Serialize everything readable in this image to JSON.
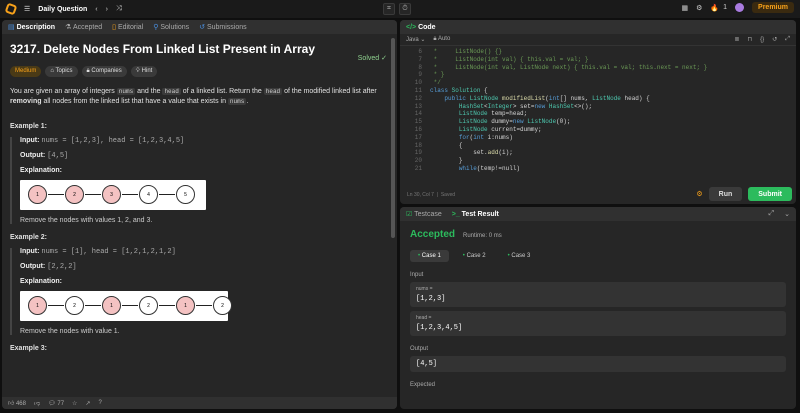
{
  "topbar": {
    "title": "Daily Question",
    "streak": "1",
    "premium": "Premium"
  },
  "left_tabs": [
    "Description",
    "Accepted",
    "Editorial",
    "Solutions",
    "Submissions"
  ],
  "problem": {
    "title": "3217. Delete Nodes From Linked List Present in Array",
    "solved": "Solved",
    "tags": [
      "Medium",
      "Topics",
      "Companies",
      "Hint"
    ],
    "desc_1": "You are given an array of integers",
    "desc_nums": "nums",
    "desc_2": "and the",
    "desc_head": "head",
    "desc_3": "of a linked list. Return the",
    "desc_head2": "head",
    "desc_4": "of the modified linked list after",
    "desc_bold": "removing",
    "desc_5": "all nodes from the linked list that have a value that exists in",
    "desc_nums2": "nums",
    "desc_6": "."
  },
  "examples": [
    {
      "title": "Example 1:",
      "input_label": "Input:",
      "input": "nums = [1,2,3], head = [1,2,3,4,5]",
      "output_label": "Output:",
      "output": "[4,5]",
      "expl_label": "Explanation:",
      "nodes": [
        {
          "v": "1",
          "r": true
        },
        {
          "v": "2",
          "r": true
        },
        {
          "v": "3",
          "r": true
        },
        {
          "v": "4",
          "r": false
        },
        {
          "v": "5",
          "r": false
        }
      ],
      "note": "Remove the nodes with values 1, 2, and 3."
    },
    {
      "title": "Example 2:",
      "input_label": "Input:",
      "input": "nums = [1], head = [1,2,1,2,1,2]",
      "output_label": "Output:",
      "output": "[2,2,2]",
      "expl_label": "Explanation:",
      "nodes": [
        {
          "v": "1",
          "r": true
        },
        {
          "v": "2",
          "r": false
        },
        {
          "v": "1",
          "r": true
        },
        {
          "v": "2",
          "r": false
        },
        {
          "v": "1",
          "r": true
        },
        {
          "v": "2",
          "r": false
        }
      ],
      "note": "Remove the nodes with value 1."
    }
  ],
  "example3_title": "Example 3:",
  "bottom": {
    "likes": "468",
    "comments": "77"
  },
  "code_panel": {
    "tab": "Code",
    "language": "Java",
    "auto": "Auto",
    "status_pos": "Ln 30, Col 7",
    "status_saved": "Saved",
    "run": "Run",
    "submit": "Submit"
  },
  "code_lines": [
    {
      "n": "6",
      "html": "<span class='cm'> *     ListNode() {}</span>"
    },
    {
      "n": "7",
      "html": "<span class='cm'> *     ListNode(int val) { this.val = val; }</span>"
    },
    {
      "n": "8",
      "html": "<span class='cm'> *     ListNode(int val, ListNode next) { this.val = val; this.next = next; }</span>"
    },
    {
      "n": "9",
      "html": "<span class='cm'> * }</span>"
    },
    {
      "n": "10",
      "html": "<span class='cm'> */</span>"
    },
    {
      "n": "11",
      "html": "<span class='kw'>class</span> <span class='ty'>Solution</span> <span class='tx'>{</span>"
    },
    {
      "n": "12",
      "html": "    <span class='kw'>public</span> <span class='ty'>ListNode</span> <span class='fn'>modifiedList</span><span class='tx'>(</span><span class='kw'>int</span><span class='tx'>[] nums, </span><span class='ty'>ListNode</span><span class='tx'> head) {</span>"
    },
    {
      "n": "13",
      "html": "        <span class='ty'>HashSet</span><span class='tx'>&lt;</span><span class='ty'>Integer</span><span class='tx'>&gt; set=</span><span class='kw'>new</span> <span class='ty'>HashSet</span><span class='tx'>&lt;&gt;();</span>"
    },
    {
      "n": "14",
      "html": "        <span class='ty'>ListNode</span> <span class='tx'>temp=head;</span>"
    },
    {
      "n": "15",
      "html": "        <span class='ty'>ListNode</span> <span class='tx'>dummy=</span><span class='kw'>new</span> <span class='ty'>ListNode</span><span class='tx'>(0);</span>"
    },
    {
      "n": "16",
      "html": "        <span class='ty'>ListNode</span> <span class='tx'>current=dummy;</span>"
    },
    {
      "n": "17",
      "html": "        <span class='kw'>for</span><span class='tx'>(</span><span class='kw'>int</span><span class='tx'> i:nums)</span>"
    },
    {
      "n": "18",
      "html": "        <span class='tx'>{</span>"
    },
    {
      "n": "19",
      "html": "            <span class='tx'>set.</span><span class='fn'>add</span><span class='tx'>(i);</span>"
    },
    {
      "n": "20",
      "html": "        <span class='tx'>}</span>"
    },
    {
      "n": "21",
      "html": "        <span class='kw'>while</span><span class='tx'>(temp!=null)</span>"
    }
  ],
  "result_panel": {
    "tab1": "Testcase",
    "tab2": "Test Result",
    "accepted": "Accepted",
    "runtime": "Runtime: 0 ms",
    "cases": [
      "Case 1",
      "Case 2",
      "Case 3"
    ],
    "input_label": "Input",
    "nums_label": "nums =",
    "nums_val": "[1,2,3]",
    "head_label": "head =",
    "head_val": "[1,2,3,4,5]",
    "output_label": "Output",
    "output_val": "[4,5]",
    "expected_label": "Expected"
  }
}
